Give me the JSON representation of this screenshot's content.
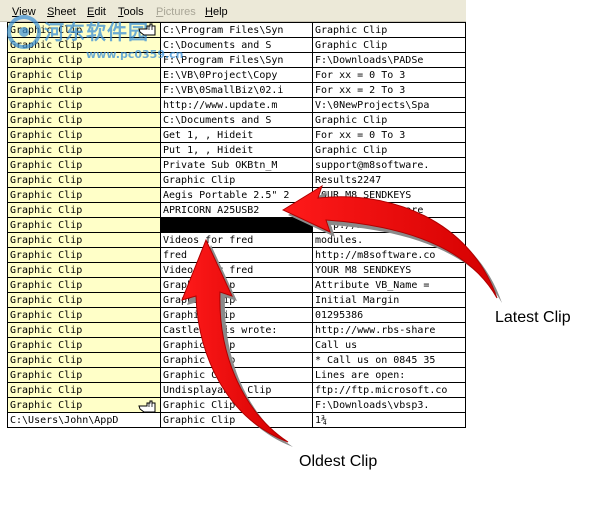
{
  "menu": {
    "items": [
      {
        "label": "View",
        "underline": "V",
        "rest": "iew",
        "enabled": true
      },
      {
        "label": "Sheet",
        "underline": "S",
        "rest": "heet",
        "enabled": true
      },
      {
        "label": "Edit",
        "underline": "E",
        "rest": "dit",
        "enabled": true
      },
      {
        "label": "Tools",
        "underline": "T",
        "rest": "ools",
        "enabled": true
      },
      {
        "label": "Pictures",
        "underline": "P",
        "rest": "ictures",
        "enabled": false
      },
      {
        "label": "Help",
        "underline": "H",
        "rest": "elp",
        "enabled": true
      }
    ]
  },
  "watermark": {
    "text": "河东软件园",
    "url": "www.pc0359.cn"
  },
  "grid": {
    "rows": [
      [
        "Graphic Clip",
        "C:\\Program Files\\Syn",
        "Graphic Clip"
      ],
      [
        "Graphic Clip",
        "C:\\Documents and S",
        "Graphic Clip"
      ],
      [
        "Graphic Clip",
        "F:\\Program Files\\Syn",
        "F:\\Downloads\\PADSe"
      ],
      [
        "Graphic Clip",
        "E:\\VB\\0Project\\Copy",
        "For xx = 0 To 3"
      ],
      [
        "Graphic Clip",
        "F:\\VB\\0SmallBiz\\02.i",
        "For xx = 2 To 3"
      ],
      [
        "Graphic Clip",
        "http://www.update.m",
        "V:\\0NewProjects\\Spa"
      ],
      [
        "Graphic Clip",
        "C:\\Documents and S",
        "Graphic Clip"
      ],
      [
        "Graphic Clip",
        "Get 1, , Hideit",
        "For xx = 0 To 3"
      ],
      [
        "Graphic Clip",
        "Put 1, , Hideit",
        "Graphic Clip"
      ],
      [
        "Graphic Clip",
        "Private Sub OKBtn_M",
        "support@m8software."
      ],
      [
        "Graphic Clip",
        "Graphic Clip",
        "Results2247"
      ],
      [
        "Graphic Clip",
        "Aegis Portable 2.5\" 2",
        "YOUR M8 SENDKEYS"
      ],
      [
        "Graphic Clip",
        "APRICORN A25USB2",
        "support@m8software"
      ],
      [
        "Graphic Clip",
        "",
        "http://m8software"
      ],
      [
        "Graphic Clip",
        "Videos for fred",
        "modules."
      ],
      [
        "Graphic Clip",
        "fred",
        "http://m8software.co"
      ],
      [
        "Graphic Clip",
        "Videos for fred",
        "YOUR M8 SENDKEYS"
      ],
      [
        "Graphic Clip",
        "Graphic Clip",
        "Attribute VB_Name ="
      ],
      [
        "Graphic Clip",
        "Graphic Clip",
        "Initial Margin"
      ],
      [
        "Graphic Clip",
        "Graphic Clip",
        "01295386"
      ],
      [
        "Graphic Clip",
        "Castle Davis wrote:",
        "http://www.rbs-share"
      ],
      [
        "Graphic Clip",
        "Graphic Clip",
        "Call us"
      ],
      [
        "Graphic Clip",
        "Graphic Clip",
        "* Call us on 0845 35"
      ],
      [
        "Graphic Clip",
        "Graphic Clip",
        "Lines are open:"
      ],
      [
        "Graphic Clip",
        "Undisplayable Clip",
        "ftp://ftp.microsoft.co"
      ],
      [
        "Graphic Clip",
        "Graphic Clip",
        "F:\\Downloads\\vbsp3."
      ],
      [
        "C:\\Users\\John\\AppD",
        "Graphic Clip",
        "1¾"
      ]
    ],
    "highlight_color": "#ffffc8",
    "black_cell": {
      "row": 13,
      "col": 1
    }
  },
  "annotations": {
    "latest": "Latest Clip",
    "oldest": "Oldest Clip",
    "arrow_color": "#ff0000"
  },
  "icons": [
    "hand-cursor-icon",
    "curved-arrow-latest-icon",
    "curved-arrow-oldest-icon",
    "watermark-logo-icon"
  ]
}
